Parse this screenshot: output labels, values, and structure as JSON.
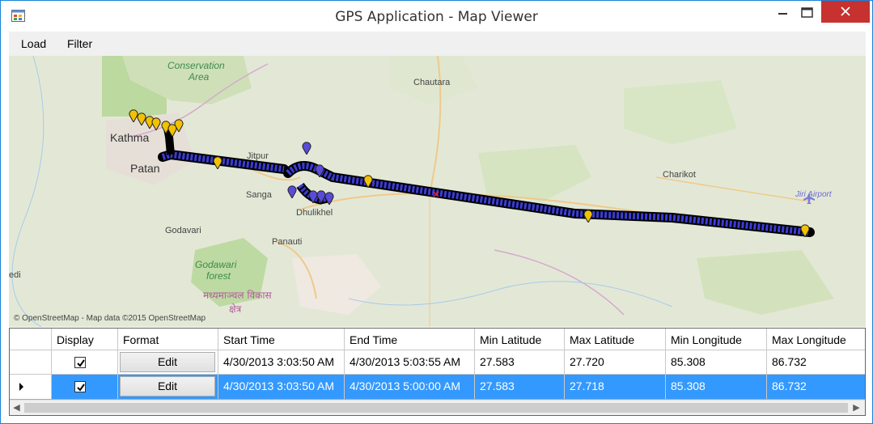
{
  "window": {
    "title": "GPS Application - Map Viewer",
    "accent": "#1883d7",
    "close_color": "#c7312f"
  },
  "menu": {
    "items": [
      "Load",
      "Filter"
    ]
  },
  "map": {
    "attribution": "© OpenStreetMap - Map data ©2015 OpenStreetMap",
    "labels": {
      "conservation": "Conservation",
      "area": "Area",
      "chautara": "Chautara",
      "kathmandu": "Kathma",
      "patan": "Patan",
      "jitpur": "Jitpur",
      "sanga": "Sanga",
      "dhulikhel": "Dhulikhel",
      "panauti": "Panauti",
      "godavari": "Godavari",
      "godawari_forest_1": "Godawari",
      "godawari_forest_2": "forest",
      "charikot": "Charikot",
      "jiri_airport": "Jiri Airport",
      "edge_label": "edi",
      "nepali_1": "मध्यमाञ्चल विकास",
      "nepali_2": "क्षेत्र"
    },
    "track_color": "#3b3bd6",
    "marker_color": "#f2c200"
  },
  "grid": {
    "headers": [
      "Display",
      "Format",
      "Start Time",
      "End Time",
      "Min Latitude",
      "Max Latitude",
      "Min Longitude",
      "Max Longitude"
    ],
    "rows": [
      {
        "display": true,
        "format": "Edit",
        "start_time": "4/30/2013 3:03:50 AM",
        "end_time": "4/30/2013 5:03:55 AM",
        "min_lat": "27.583",
        "max_lat": "27.720",
        "min_lon": "85.308",
        "max_lon": "86.732",
        "selected": false
      },
      {
        "display": true,
        "format": "Edit",
        "start_time": "4/30/2013 3:03:50 AM",
        "end_time": "4/30/2013 5:00:00 AM",
        "min_lat": "27.583",
        "max_lat": "27.718",
        "min_lon": "85.308",
        "max_lon": "86.732",
        "selected": true
      }
    ],
    "selection_color": "#3399ff"
  }
}
